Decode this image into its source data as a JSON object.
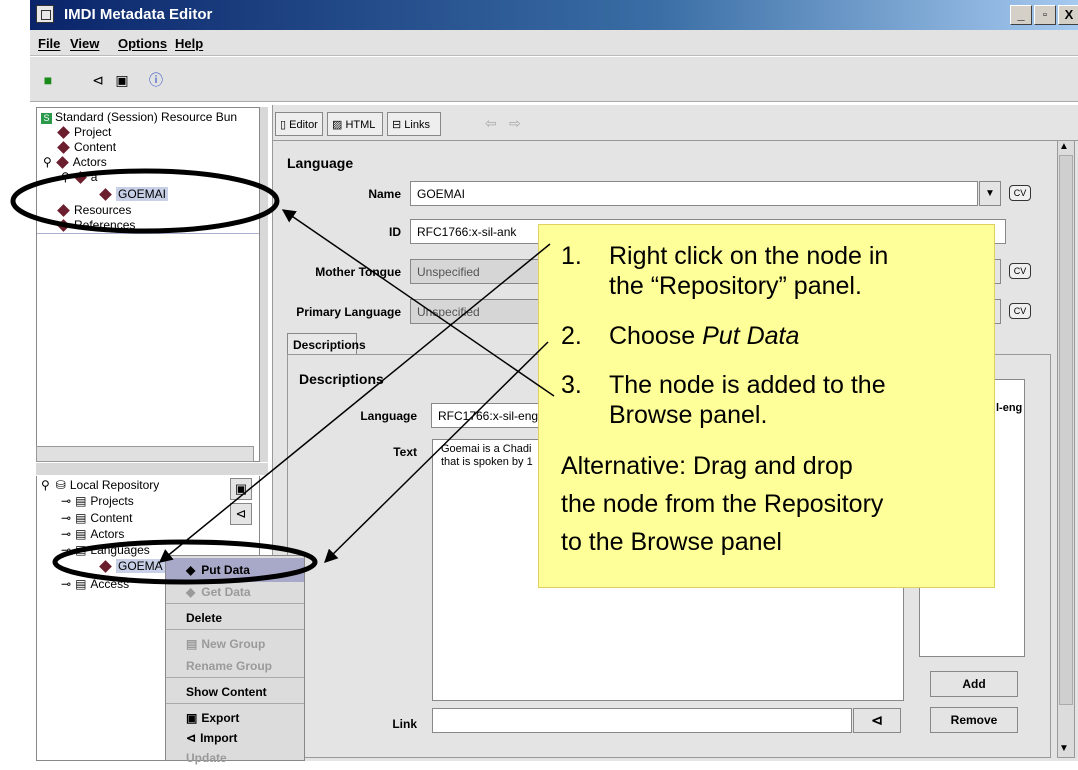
{
  "window": {
    "title": "IMDI Metadata Editor",
    "buttons": [
      "_",
      "▫",
      "X"
    ]
  },
  "menu": {
    "items": [
      "File",
      "View",
      "Options",
      "Help"
    ]
  },
  "toolbar": {
    "icons": [
      "new-icon",
      "open-icon",
      "save-icon",
      "info-icon"
    ]
  },
  "browse_tree": {
    "root": "Standard (Session) Resource Bun",
    "root_badge": "S",
    "items": [
      {
        "label": "Project"
      },
      {
        "label": "Content"
      },
      {
        "label": "Actors"
      },
      {
        "label": "a"
      },
      {
        "label": "GOEMAI"
      },
      {
        "label": "Resources"
      },
      {
        "label": "References"
      }
    ]
  },
  "repository_tree": {
    "root": "Local Repository",
    "items": [
      {
        "label": "Projects"
      },
      {
        "label": "Content"
      },
      {
        "label": "Actors"
      },
      {
        "label": "Languages"
      },
      {
        "label": "GOEMA"
      },
      {
        "label": "Access"
      }
    ]
  },
  "context_menu": {
    "items": [
      {
        "label": "Put Data",
        "enabled": true,
        "highlighted": true
      },
      {
        "label": "Get Data",
        "enabled": false
      },
      {
        "label": "Delete",
        "enabled": true
      },
      {
        "label": "New Group",
        "enabled": false
      },
      {
        "label": "Rename Group",
        "enabled": false
      },
      {
        "label": "Show Content",
        "enabled": true
      },
      {
        "label": "Export",
        "enabled": true
      },
      {
        "label": "Import",
        "enabled": true
      },
      {
        "label": "Update",
        "enabled": false
      }
    ]
  },
  "editor": {
    "tabs": [
      "Editor",
      "HTML",
      "Links"
    ],
    "section_title": "Language",
    "fields": {
      "name_label": "Name",
      "name_value": "GOEMAI",
      "id_label": "ID",
      "id_value": "RFC1766:x-sil-ank",
      "mother_tongue_label": "Mother Tongue",
      "mother_tongue_value": "Unspecified",
      "primary_language_label": "Primary Language",
      "primary_language_value": "Unspecified"
    },
    "cv_label": "CV",
    "descriptions_tab": "Descriptions",
    "descriptions_title": "Descriptions",
    "desc_language_label": "Language",
    "desc_language_value": "RFC1766:x-sil-eng",
    "desc_text_label": "Text",
    "desc_text_line1": "Goemai is a Chadi",
    "desc_text_line2": "that is spoken by 1",
    "desc_list_item": "l-eng",
    "link_label": "Link",
    "add_button": "Add",
    "remove_button": "Remove"
  },
  "callout": {
    "step1_num": "1.",
    "step1_line1": "Right click on the node in",
    "step1_line2": "the “Repository” panel.",
    "step2_num": "2.",
    "step2_text": "Choose ",
    "step2_em": "Put Data",
    "step3_num": "3.",
    "step3_line1": "The node is added to the",
    "step3_line2": "Browse panel.",
    "alt_line1": "Alternative: Drag and drop",
    "alt_line2": "the node from the Repository",
    "alt_line3": "to the Browse panel"
  },
  "colors": {
    "titlebar": "#0a246a",
    "callout_bg": "#ffff99",
    "node_diamond": "#6b1e2e",
    "selection": "#c8d0e8"
  }
}
